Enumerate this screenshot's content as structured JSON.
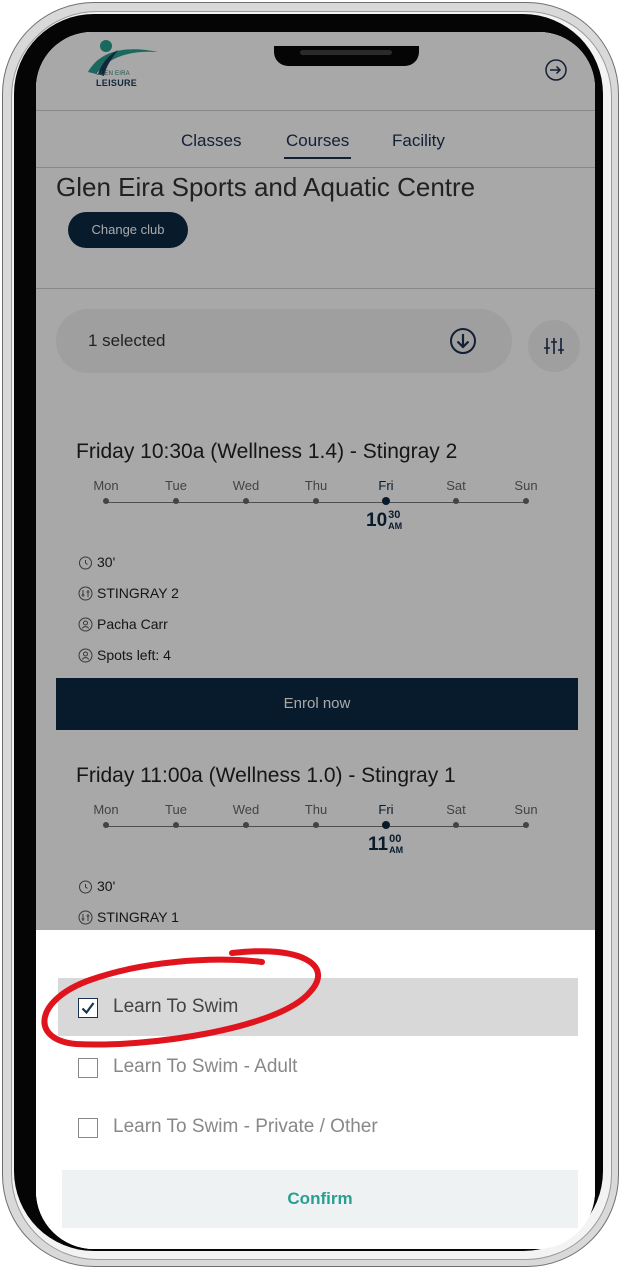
{
  "header": {
    "logo_small": "GLEN EIRA",
    "logo_big": "LEISURE",
    "logout_icon": "logout-icon"
  },
  "nav": {
    "tabs": [
      {
        "label": "Classes"
      },
      {
        "label": "Courses",
        "active": true
      },
      {
        "label": "Facility"
      }
    ]
  },
  "club": {
    "title": "Glen Eira Sports and Aquatic Centre",
    "change_button": "Change club"
  },
  "filter": {
    "selected_text": "1 selected",
    "arrow_icon": "arrow-down-circle-icon",
    "filter_icon": "sliders-icon"
  },
  "days": [
    "Mon",
    "Tue",
    "Wed",
    "Thu",
    "Fri",
    "Sat",
    "Sun"
  ],
  "courses": [
    {
      "title": "Friday 10:30a (Wellness 1.4) - Stingray 2",
      "active_day": "Fri",
      "time_hour": "10",
      "time_min": "30",
      "time_ampm": "AM",
      "duration": "30'",
      "location": "STINGRAY 2",
      "instructor": "Pacha Carr",
      "spots": "Spots left: 4",
      "button": "Enrol now"
    },
    {
      "title": "Friday 11:00a (Wellness 1.0) - Stingray 1",
      "active_day": "Fri",
      "time_hour": "11",
      "time_min": "00",
      "time_ampm": "AM",
      "duration": "30'",
      "location": "STINGRAY 1"
    }
  ],
  "sheet": {
    "options": [
      {
        "label": "Learn To Swim",
        "checked": true
      },
      {
        "label": "Learn To Swim - Adult",
        "checked": false
      },
      {
        "label": "Learn To Swim - Private / Other",
        "checked": false
      }
    ],
    "confirm": "Confirm"
  },
  "colors": {
    "navy": "#0d2a45",
    "teal": "#2a9e8f",
    "annotation_red": "#e0141c"
  }
}
